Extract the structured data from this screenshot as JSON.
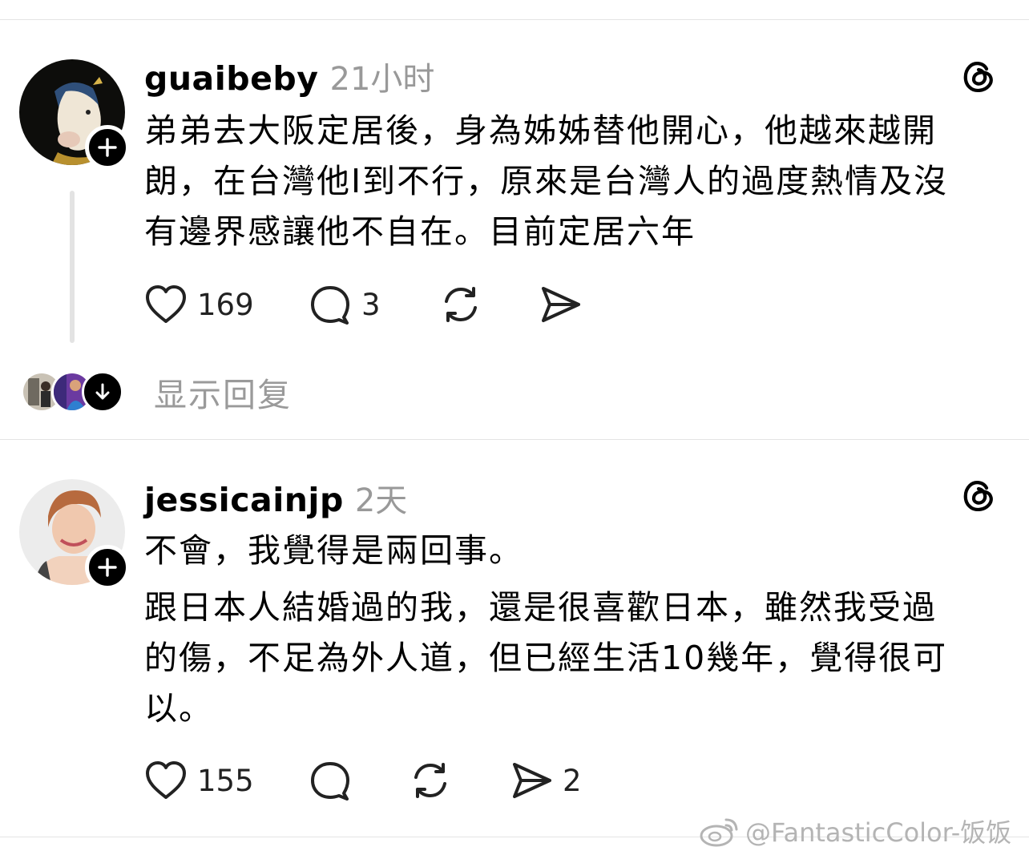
{
  "posts": [
    {
      "username": "guaibeby",
      "time": "21小时",
      "lines": [
        "弟弟去大阪定居後，身為姊姊替他開心，他越來越開",
        "朗，在台灣他I到不行，原來是台灣人的過度熱情及沒",
        "有邊界感讓他不自在。目前定居六年"
      ],
      "likes": "169",
      "comments": "3",
      "reposts": "",
      "shares": "",
      "show_replies": "显示回复"
    },
    {
      "username": "jessicainjp",
      "time": "2天",
      "lines": [
        "不會，我覺得是兩回事。",
        "跟日本人結婚過的我，還是很喜歡日本，雖然我受過",
        "的傷，不足為外人道，但已經生活10幾年，覺得很可",
        "以。"
      ],
      "likes": "155",
      "comments": "",
      "reposts": "",
      "shares": "2"
    }
  ],
  "watermark": "@FantasticColor-饭饭",
  "icons": [
    "heart-icon",
    "comment-icon",
    "repost-icon",
    "share-icon",
    "threads-logo-icon",
    "plus-icon",
    "arrow-down-icon",
    "weibo-logo-icon"
  ]
}
